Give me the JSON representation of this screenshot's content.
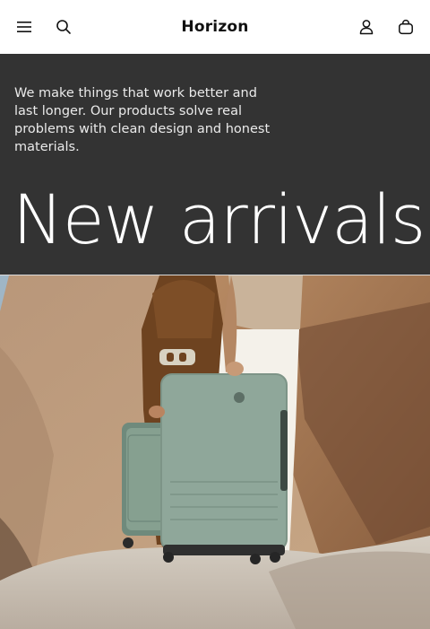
{
  "header": {
    "brand": "Horizon",
    "icons": {
      "menu": "menu-icon",
      "search": "search-icon",
      "account": "account-icon",
      "cart": "cart-icon"
    }
  },
  "hero": {
    "intro": "We make things that work better and last longer. Our products solve real problems with clean design and honest materials.",
    "title": "New arrivals"
  },
  "photo": {
    "subject": "hero-image"
  },
  "colors": {
    "hero_bg": "#333333",
    "header_bg": "#ffffff",
    "suitcase": "#8fa79a"
  }
}
